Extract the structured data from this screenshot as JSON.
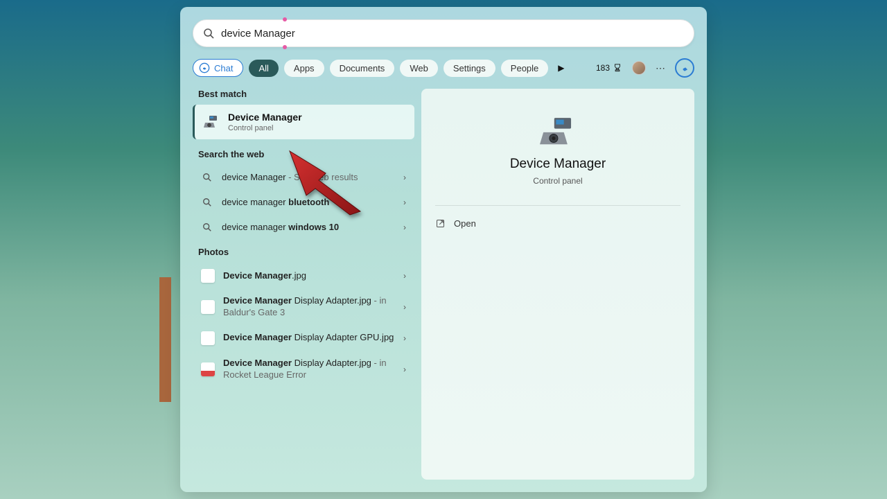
{
  "search": {
    "value": "device Manager"
  },
  "filters": {
    "chat": "Chat",
    "tabs": [
      "All",
      "Apps",
      "Documents",
      "Web",
      "Settings",
      "People"
    ],
    "active_index": 0,
    "points": "183"
  },
  "left": {
    "best_match_header": "Best match",
    "best_match": {
      "title": "Device Manager",
      "subtitle": "Control panel"
    },
    "web_header": "Search the web",
    "web_items": [
      {
        "prefix": "device Manager",
        "suffix": " - See web results",
        "bold_prefix": false
      },
      {
        "prefix": "device manager ",
        "bold": "bluetooth"
      },
      {
        "prefix": "device manager ",
        "bold": "windows 10"
      }
    ],
    "photos_header": "Photos",
    "photo_items": [
      {
        "bold": "Device Manager",
        "rest": ".jpg"
      },
      {
        "bold": "Device Manager",
        "rest": " Display Adapter.jpg",
        "loc": " - in Baldur's Gate 3"
      },
      {
        "bold": "Device Manager",
        "rest": " Display Adapter GPU.jpg"
      },
      {
        "bold": "Device Manager",
        "rest": " Display Adapter.jpg",
        "loc": " - in Rocket League Error"
      }
    ]
  },
  "detail": {
    "title": "Device Manager",
    "subtitle": "Control panel",
    "open_label": "Open"
  }
}
